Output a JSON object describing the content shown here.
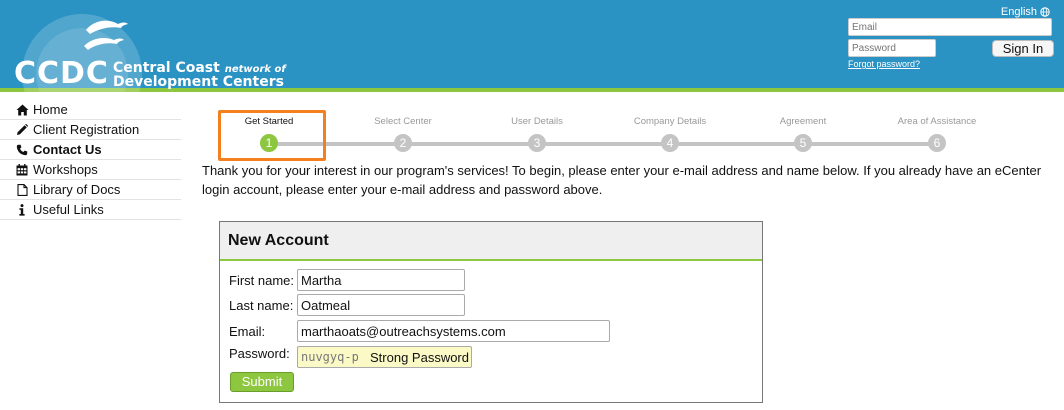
{
  "header": {
    "logo_abbr": "CCDC",
    "logo_line1": "Central Coast",
    "logo_line1_small": "network of",
    "logo_line2": "Development Centers",
    "language": "English",
    "email_placeholder": "Email",
    "password_placeholder": "Password",
    "signin_label": "Sign In",
    "forgot_label": "Forgot password?"
  },
  "sidebar": {
    "items": [
      {
        "label": "Home",
        "icon": "home-icon"
      },
      {
        "label": "Client Registration",
        "icon": "pencil-icon"
      },
      {
        "label": "Contact Us",
        "icon": "phone-icon"
      },
      {
        "label": "Workshops",
        "icon": "calendar-icon"
      },
      {
        "label": "Library of Docs",
        "icon": "document-icon"
      },
      {
        "label": "Useful Links",
        "icon": "info-icon"
      }
    ]
  },
  "stepper": {
    "steps": [
      {
        "label": "Get Started",
        "number": "1"
      },
      {
        "label": "Select Center",
        "number": "2"
      },
      {
        "label": "User Details",
        "number": "3"
      },
      {
        "label": "Company Details",
        "number": "4"
      },
      {
        "label": "Agreement",
        "number": "5"
      },
      {
        "label": "Area of Assistance",
        "number": "6"
      }
    ],
    "current": 1
  },
  "intro_text": "Thank you for your interest in our program's services! To begin, please enter your e-mail address and name below. If you already have an eCenter login account, please enter your e-mail address and password above.",
  "form": {
    "title": "New Account",
    "first_name_label": "First name:",
    "first_name_value": "Martha",
    "last_name_label": "Last name:",
    "last_name_value": "Oatmeal",
    "email_label": "Email:",
    "email_value": "marthaoats@outreachsystems.com",
    "password_label": "Password:",
    "password_value": "nuvgyq-p",
    "password_suggestion": "Strong Password",
    "submit_label": "Submit"
  },
  "colors": {
    "header_blue": "#2b93c4",
    "accent_green": "#8dc63f",
    "highlight_orange": "#f47f1f",
    "step_gray": "#c4c4c4"
  }
}
